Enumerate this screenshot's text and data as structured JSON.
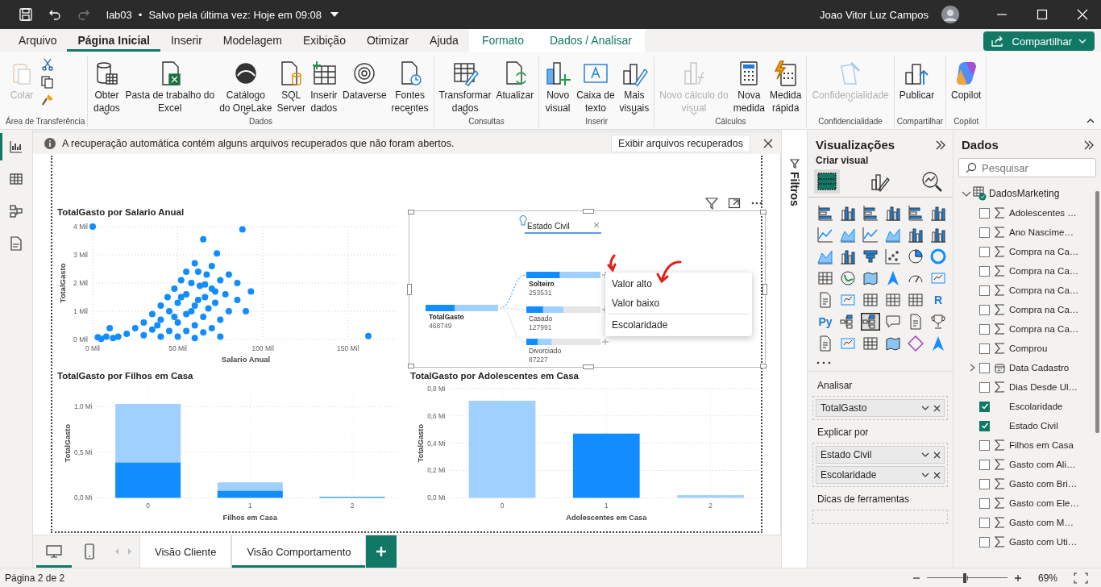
{
  "title_bar": {
    "quick_access": [
      {
        "disabled": false
      },
      {
        "disabled": false
      },
      {
        "disabled": true
      }
    ],
    "file_name": "lab03",
    "separator": "•",
    "save_status": "Salvo pela última vez: Hoje em 09:08",
    "user": "Joao Vitor Luz Campos"
  },
  "tabs": [
    {
      "label": "Arquivo",
      "selected": false,
      "contextual": false
    },
    {
      "label": "Página Inicial",
      "selected": true,
      "contextual": false
    },
    {
      "label": "Inserir",
      "selected": false,
      "contextual": false
    },
    {
      "label": "Modelagem",
      "selected": false,
      "contextual": false
    },
    {
      "label": "Exibição",
      "selected": false,
      "contextual": false
    },
    {
      "label": "Otimizar",
      "selected": false,
      "contextual": false
    },
    {
      "label": "Ajuda",
      "selected": false,
      "contextual": false
    },
    {
      "label": "Formato",
      "selected": false,
      "contextual": true
    },
    {
      "label": "Dados / Analisar",
      "selected": false,
      "contextual": true
    }
  ],
  "share_button": "Compartilhar",
  "ribbon": [
    {
      "label": "Área de Transferência",
      "buttons": [
        {
          "label": "Colar",
          "menu": false,
          "disabled": true
        }
      ]
    },
    {
      "label": "Dados",
      "buttons": [
        {
          "label": "Obter\ndados",
          "menu": true,
          "disabled": false
        },
        {
          "label": "Pasta de trabalho do\nExcel",
          "menu": false,
          "disabled": false
        },
        {
          "label": "Catálogo\ndo OneLake",
          "menu": true,
          "disabled": false
        },
        {
          "label": "SQL\nServer",
          "menu": false,
          "disabled": false
        },
        {
          "label": "Inserir\ndados",
          "menu": false,
          "disabled": false
        },
        {
          "label": "Dataverse",
          "menu": false,
          "disabled": false
        },
        {
          "label": "Fontes\nrecentes",
          "menu": true,
          "disabled": false
        }
      ]
    },
    {
      "label": "Consultas",
      "buttons": [
        {
          "label": "Transformar\ndados",
          "menu": true,
          "disabled": false
        },
        {
          "label": "Atualizar",
          "menu": false,
          "disabled": false
        }
      ]
    },
    {
      "label": "Inserir",
      "buttons": [
        {
          "label": "Novo\nvisual",
          "menu": false,
          "disabled": false
        },
        {
          "label": "Caixa de\ntexto",
          "menu": false,
          "disabled": false
        },
        {
          "label": "Mais\nvisuais",
          "menu": true,
          "disabled": false
        }
      ]
    },
    {
      "label": "Cálculos",
      "buttons": [
        {
          "label": "Novo cálculo do\nvisual",
          "menu": true,
          "disabled": true
        },
        {
          "label": "Nova\nmedida",
          "menu": false,
          "disabled": false
        },
        {
          "label": "Medida\nrápida",
          "menu": false,
          "disabled": false
        }
      ]
    },
    {
      "label": "Confidencialidade",
      "buttons": [
        {
          "label": "Confidencialidade",
          "menu": true,
          "disabled": true
        }
      ]
    },
    {
      "label": "Compartilhar",
      "buttons": [
        {
          "label": "Publicar",
          "menu": false,
          "disabled": false
        }
      ]
    },
    {
      "label": "Copilot",
      "buttons": [
        {
          "label": "Copilot",
          "menu": false,
          "disabled": false
        }
      ]
    }
  ],
  "left_rail": [
    {
      "selected": true
    },
    {
      "selected": false
    },
    {
      "selected": false
    },
    {
      "selected": false
    }
  ],
  "info_bar": {
    "message": "A recuperação automática contém alguns arquivos recuperados que não foram abertos.",
    "action": "Exibir arquivos recuperados"
  },
  "report": {
    "scatter": {
      "chart_data": {
        "type": "scatter",
        "title": "TotalGasto por Salario Anual",
        "xlabel": "Salario Anual",
        "ylabel": "TotalGasto",
        "x": [
          0,
          88,
          162,
          65,
          73,
          60,
          70,
          55,
          62,
          67,
          80,
          52,
          58,
          75,
          85,
          93,
          48,
          63,
          70,
          78,
          44,
          55,
          66,
          72,
          85,
          40,
          50,
          60,
          68,
          80,
          35,
          45,
          55,
          65,
          75,
          90,
          30,
          40,
          50,
          60,
          70,
          25,
          35,
          45,
          55,
          65,
          20,
          30,
          40,
          50,
          12,
          8,
          5,
          15,
          3,
          10,
          75,
          60,
          38,
          48,
          58,
          52,
          66,
          62,
          72
        ],
        "grid": true,
        "series": [
          {
            "color": "#118dff",
            "values": [
              4.0,
              3.9,
              0.12,
              3.55,
              3.05,
              2.7,
              2.6,
              2.4,
              2.4,
              2.3,
              2.3,
              2.1,
              2.0,
              2.1,
              2.0,
              1.7,
              1.8,
              1.9,
              1.8,
              1.6,
              1.5,
              1.6,
              1.5,
              1.3,
              1.4,
              1.2,
              1.3,
              1.2,
              1.1,
              1.0,
              0.9,
              1.0,
              0.9,
              0.8,
              0.7,
              1.0,
              0.6,
              0.7,
              0.6,
              0.5,
              0.4,
              0.4,
              0.35,
              0.3,
              0.3,
              0.25,
              0.2,
              0.15,
              0.1,
              0.1,
              0.05,
              0.1,
              0.02,
              0.1,
              0.08,
              0.4,
              0.1,
              0.05,
              0.5,
              0.8,
              1.0,
              1.5,
              1.95,
              1.4,
              1.7
            ]
          }
        ],
        "xlim": [
          0,
          180
        ],
        "ylim": [
          0,
          4
        ],
        "xticks": [
          {
            "value": 0,
            "label": "0 Mil"
          },
          {
            "value": 50,
            "label": "50 Mil"
          },
          {
            "value": 100,
            "label": "100 Mil"
          },
          {
            "value": 150,
            "label": "150 Mil"
          }
        ],
        "yticks": [
          {
            "value": 0,
            "label": "0 Mil"
          },
          {
            "value": 1,
            "label": "1 Mil"
          },
          {
            "value": 2,
            "label": "2 Mil"
          },
          {
            "value": 3,
            "label": "3 Mil"
          },
          {
            "value": 4,
            "label": "4 Mil"
          }
        ]
      }
    },
    "decomposition": {
      "header": "Estado Civil",
      "root": {
        "label": "TotalGasto",
        "value": "468749",
        "level": 1
      },
      "nodes": [
        {
          "label": "Solteiro",
          "value": "253531",
          "level": 1,
          "selected": true
        },
        {
          "label": "Casado",
          "value": "127991",
          "level": 0.5,
          "selected": false
        },
        {
          "label": "Divorciado",
          "value": "87227",
          "level": 0.34,
          "selected": false
        }
      ],
      "menu": [
        {
          "label": "Valor alto",
          "divider_before": false
        },
        {
          "label": "Valor baixo",
          "divider_before": false
        },
        {
          "label": "Escolaridade",
          "divider_before": true
        }
      ]
    },
    "bar_children": {
      "chart_data": {
        "type": "bar",
        "title": "TotalGasto por Filhos em Casa",
        "xlabel": "Filhos em Casa",
        "ylabel": "TotalGasto",
        "categories": [
          "0",
          "1",
          "2"
        ],
        "series": [
          {
            "color": "#118dff",
            "values": [
              0.39,
              0.08,
              0.01
            ]
          },
          {
            "color": "#a0d0ff",
            "values": [
              0.64,
              0.09,
              0
            ]
          }
        ],
        "stacked": true,
        "grid": true,
        "ylim": [
          0,
          1.2
        ],
        "yticks": [
          {
            "value": 0,
            "label": "0,0 Mi"
          },
          {
            "value": 0.5,
            "label": "0,5 Mi"
          },
          {
            "value": 1,
            "label": "1,0 Mi"
          }
        ]
      }
    },
    "bar_teens": {
      "chart_data": {
        "type": "bar",
        "title": "TotalGasto por Adolescentes em Casa",
        "xlabel": "Adolescentes em Casa",
        "ylabel": "TotalGasto",
        "categories": [
          "0",
          "1",
          "2"
        ],
        "series": [
          {
            "color": "#118dff",
            "values": [
              0,
              0.47,
              0
            ]
          },
          {
            "color": "#a0d0ff",
            "values": [
              0.71,
              0,
              0.02
            ]
          }
        ],
        "stacked": true,
        "grid": true,
        "ylim": [
          0,
          0.8
        ],
        "yticks": [
          {
            "value": 0,
            "label": "0,0 Mi"
          },
          {
            "value": 0.2,
            "label": "0,2 Mi"
          },
          {
            "value": 0.4,
            "label": "0,4 Mi"
          },
          {
            "value": 0.6,
            "label": "0,6 Mi"
          },
          {
            "value": 0.8,
            "label": "0,8 Mi"
          }
        ]
      }
    }
  },
  "filters_pane": {
    "label": "Filtros"
  },
  "visualizations": {
    "title": "Visualizações",
    "subtitle": "Criar visual",
    "modes": [
      {
        "selected": true
      },
      {
        "selected": false
      },
      {
        "selected": false
      }
    ],
    "gallery": [
      {
        "selected": false
      },
      {
        "selected": false
      },
      {
        "selected": false
      },
      {
        "selected": false
      },
      {
        "selected": false
      },
      {
        "selected": false
      },
      {
        "selected": false
      },
      {
        "selected": false
      },
      {
        "selected": false
      },
      {
        "selected": false
      },
      {
        "selected": false
      },
      {
        "selected": false
      },
      {
        "selected": false
      },
      {
        "selected": false
      },
      {
        "selected": false
      },
      {
        "selected": false
      },
      {
        "selected": false
      },
      {
        "selected": false
      },
      {
        "selected": false
      },
      {
        "selected": false
      },
      {
        "selected": false
      },
      {
        "selected": false
      },
      {
        "selected": false
      },
      {
        "selected": false
      },
      {
        "selected": false
      },
      {
        "selected": false
      },
      {
        "selected": false
      },
      {
        "selected": false
      },
      {
        "selected": false
      },
      {
        "label": "R",
        "selected": false
      },
      {
        "label": "Py",
        "selected": false
      },
      {
        "selected": false
      },
      {
        "selected": true
      },
      {
        "selected": false
      },
      {
        "selected": false
      },
      {
        "selected": false
      },
      {
        "selected": false
      },
      {
        "selected": false
      },
      {
        "selected": false
      },
      {
        "selected": false
      },
      {
        "selected": false
      },
      {
        "selected": false
      }
    ],
    "wells": [
      {
        "label": "Analisar",
        "fields": [
          "TotalGasto"
        ]
      },
      {
        "label": "Explicar por",
        "fields": [
          "Estado Civil",
          "Escolaridade"
        ]
      },
      {
        "label": "Dicas de ferramentas"
      }
    ]
  },
  "data_pane": {
    "title": "Dados",
    "search_placeholder": "Pesquisar",
    "tree": {
      "label": "DadosMarketing",
      "expanded": true,
      "children": [
        {
          "label": "Adolescentes …",
          "kind": "measure",
          "checked": false
        },
        {
          "label": "Ano Nascime…",
          "kind": "measure",
          "checked": false
        },
        {
          "label": "Compra na Ca…",
          "kind": "measure",
          "checked": false
        },
        {
          "label": "Compra na Ca…",
          "kind": "measure",
          "checked": false
        },
        {
          "label": "Compra na Ca…",
          "kind": "measure",
          "checked": false
        },
        {
          "label": "Compra na Ca…",
          "kind": "measure",
          "checked": false
        },
        {
          "label": "Compra na Ca…",
          "kind": "measure",
          "checked": false
        },
        {
          "label": "Comprou",
          "kind": "measure",
          "checked": false
        },
        {
          "label": "Data Cadastro",
          "kind": "date",
          "checked": false,
          "expanded": false
        },
        {
          "label": "Dias Desde Ul…",
          "kind": "measure",
          "checked": false
        },
        {
          "label": "Escolaridade",
          "kind": "text",
          "checked": true
        },
        {
          "label": "Estado Civil",
          "kind": "text",
          "checked": true
        },
        {
          "label": "Filhos em Casa",
          "kind": "measure",
          "checked": false
        },
        {
          "label": "Gasto com Ali…",
          "kind": "measure",
          "checked": false
        },
        {
          "label": "Gasto com Bri…",
          "kind": "measure",
          "checked": false
        },
        {
          "label": "Gasto com Ele…",
          "kind": "measure",
          "checked": false
        },
        {
          "label": "Gasto com M…",
          "kind": "measure",
          "checked": false
        },
        {
          "label": "Gasto com Uti…",
          "kind": "measure",
          "checked": false
        }
      ]
    }
  },
  "page_tabs": {
    "views": [
      {
        "selected": true
      },
      {
        "selected": false
      }
    ],
    "pages": [
      {
        "label": "Visão Cliente",
        "selected": false
      },
      {
        "label": "Visão Comportamento",
        "selected": true
      }
    ]
  },
  "status_bar": {
    "page": "Página 2 de 2",
    "zoom": {
      "level": 0.47
    },
    "zoom_label": "69%"
  }
}
